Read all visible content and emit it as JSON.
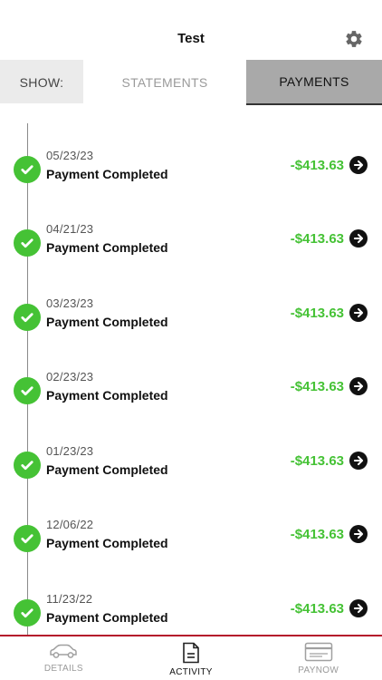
{
  "header": {
    "title": "Test",
    "settings_icon": "gear-icon"
  },
  "tabs": {
    "show_label": "SHOW:",
    "statements_label": "STATEMENTS",
    "payments_label": "PAYMENTS",
    "active": "PAYMENTS"
  },
  "payments": [
    {
      "date": "05/23/23",
      "status": "Payment Completed",
      "amount": "-$413.63"
    },
    {
      "date": "04/21/23",
      "status": "Payment Completed",
      "amount": "-$413.63"
    },
    {
      "date": "03/23/23",
      "status": "Payment Completed",
      "amount": "-$413.63"
    },
    {
      "date": "02/23/23",
      "status": "Payment Completed",
      "amount": "-$413.63"
    },
    {
      "date": "01/23/23",
      "status": "Payment Completed",
      "amount": "-$413.63"
    },
    {
      "date": "12/06/22",
      "status": "Payment Completed",
      "amount": "-$413.63"
    },
    {
      "date": "11/23/22",
      "status": "Payment Completed",
      "amount": "-$413.63"
    }
  ],
  "bottom_nav": {
    "details_label": "DETAILS",
    "activity_label": "ACTIVITY",
    "paynow_label": "PAYNOW",
    "active": "ACTIVITY"
  },
  "colors": {
    "accent_green": "#45c235",
    "nav_border": "#b5162b",
    "active_tab_bg": "#a9a9a9"
  }
}
